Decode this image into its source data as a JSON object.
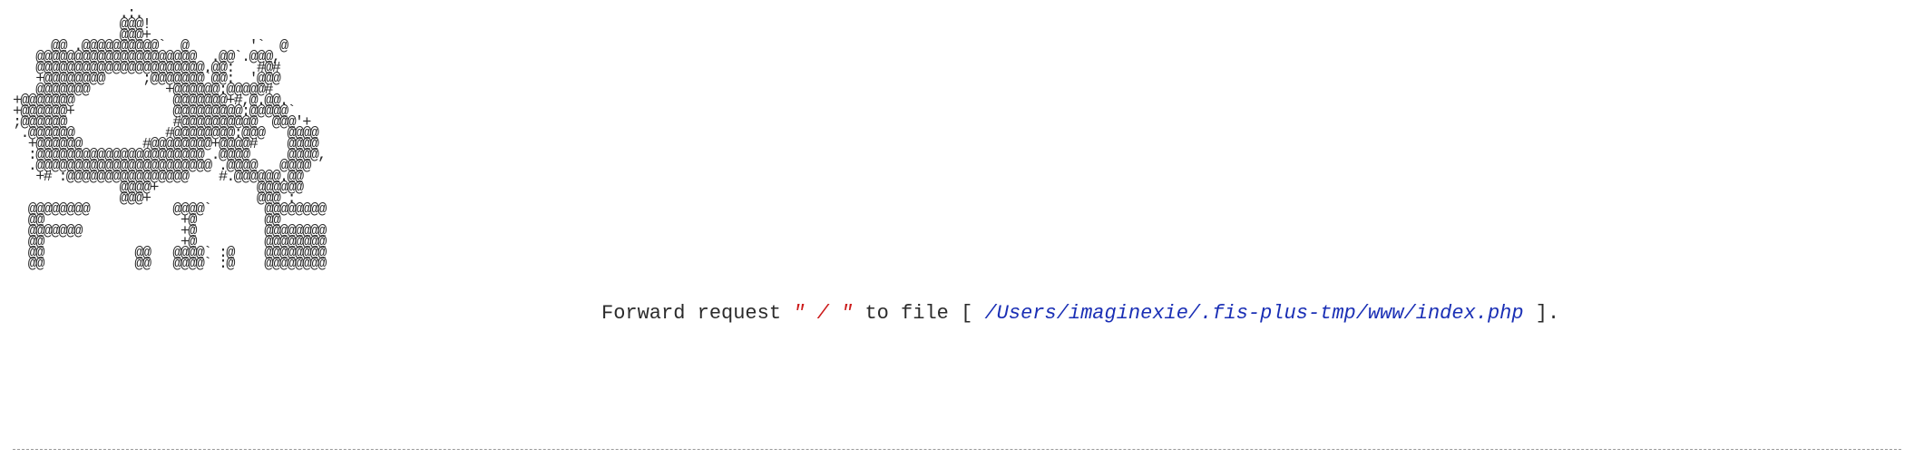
{
  "logo": {
    "ascii_art": "              .:.\n              @@@!\n              @@@+\n     @@ .@@@@@@@@@@`  @        '`  @\n   @@@@@@@@@@@@@@@@@@@@@  .@@`.@@@,\n   @@@@@@@@@@@@@@@@@@@@@@.@@:   #@#\n   +@@@@@@@@     ;@@@@@@@`@@:  '@@@\n   @@@@@@@          +@@@@@@:@@@@@#\n+@@@@@@@             @@@@@@@+#,@.@@.\n+@@@@@@+             @@@@@@@@@:@@@@@`\n;@@@@@@              #@@@@@@@@@@  @@@'+\n .@@@@@@            #@@@@@@@@:@@@   @@@@\n  +@@@@@@        #@@@@@@@@+@@@@#    @@@@\n  :@@@@@@@@@@@@@@@@@@@@@@ .@@@@     @@@@,\n  .@@@@@@@@@@@@@@@@@@@@@@@ .@@@@   @@@@\n   +# :@@@@@@@@@@@@@@@@    #.@@@@@@.@@\n              @@@@+             @@@@@@\n              @@@+              @@@ :\n  @@@@@@@@           @@@@`       @@@@@@@@\n  @@                  +@         @@\n  @@@@@@@             +@         @@@@@@@@\n  @@                  +@         @@@@@@@@\n  @@            @@   @@@@` :@    @@@@@@@@\n  @@            @@   @@@@` :@    @@@@@@@@"
  },
  "message": {
    "prefix": "Forward request ",
    "route": "\" / \"",
    "middle": " to file [ ",
    "file_path": "/Users/imaginexie/.fis-plus-tmp/www/index.php",
    "suffix": " ]."
  },
  "colors": {
    "route_text": "#cc1a1a",
    "path_text": "#1a2fb5",
    "body_text": "#2b2b2b",
    "divider": "#9a9a9a"
  }
}
